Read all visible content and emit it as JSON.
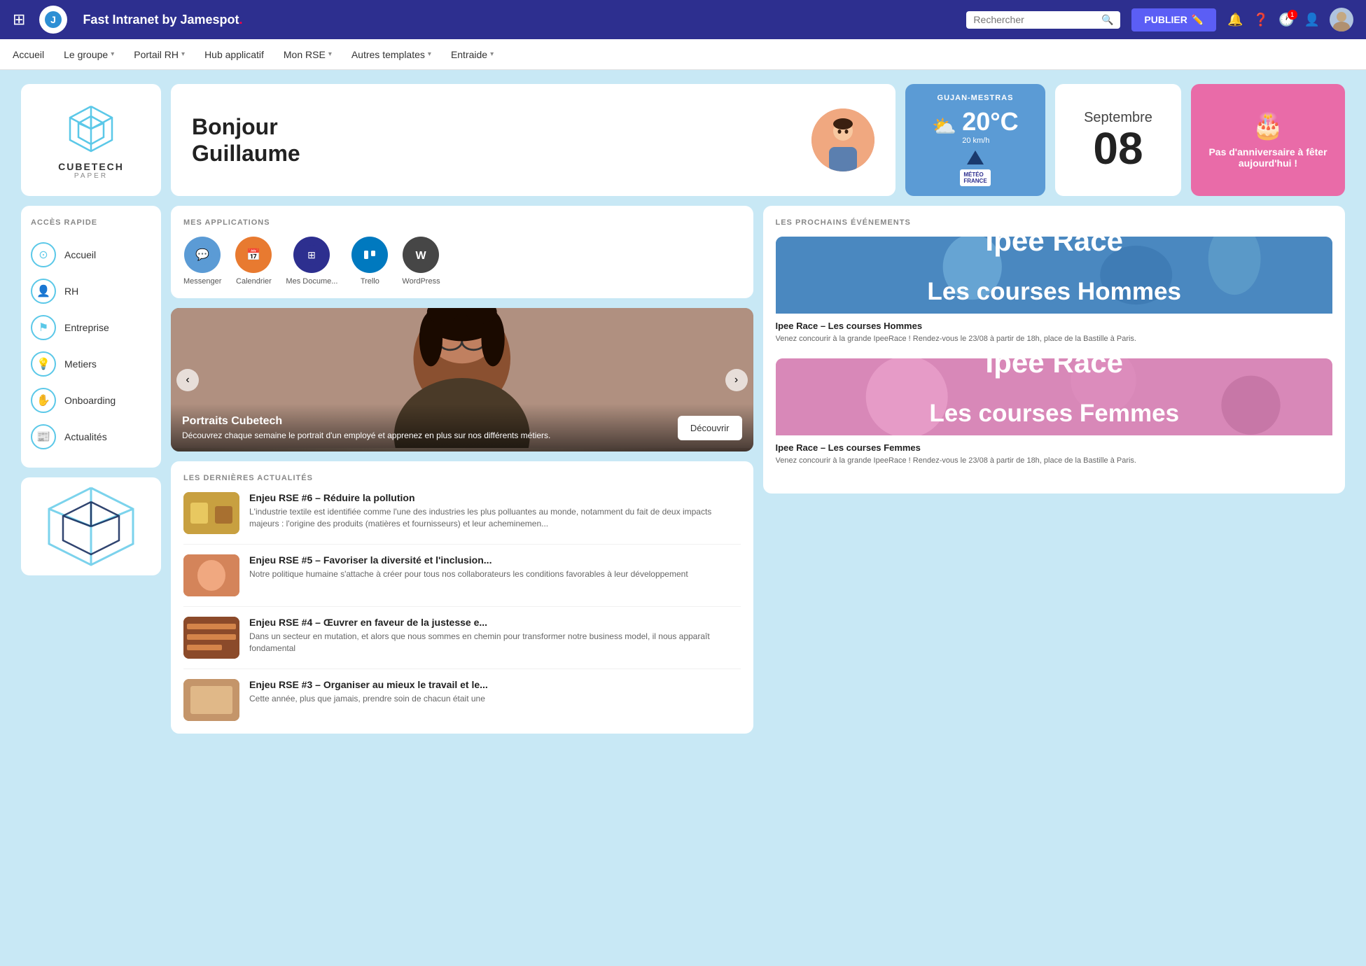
{
  "brand": {
    "title": "Fast Intranet by Jamespot",
    "title_part1": "Fast Intranet by Jamespot",
    "dot": "."
  },
  "topnav": {
    "search_placeholder": "Rechercher",
    "publish_label": "PUBLIER",
    "notification_count": "1"
  },
  "secnav": {
    "items": [
      {
        "label": "Accueil",
        "has_dropdown": false
      },
      {
        "label": "Le groupe",
        "has_dropdown": true
      },
      {
        "label": "Portail RH",
        "has_dropdown": true
      },
      {
        "label": "Hub applicatif",
        "has_dropdown": false
      },
      {
        "label": "Mon RSE",
        "has_dropdown": true
      },
      {
        "label": "Autres templates",
        "has_dropdown": true
      },
      {
        "label": "Entraide",
        "has_dropdown": true
      }
    ]
  },
  "greeting": {
    "line1": "Bonjour",
    "line2": "Guillaume"
  },
  "weather": {
    "city": "GUJAN-MESTRAS",
    "temp": "20°C",
    "wind": "20 km/h",
    "logo": "MÉTÉO FRANCE"
  },
  "date": {
    "month": "Septembre",
    "day": "08"
  },
  "birthday": {
    "message": "Pas d'anniversaire à fêter aujourd'hui !"
  },
  "quick_access": {
    "title": "ACCÈS RAPIDE",
    "items": [
      {
        "label": "Accueil",
        "icon": "⊙"
      },
      {
        "label": "RH",
        "icon": "👤"
      },
      {
        "label": "Entreprise",
        "icon": "⚑"
      },
      {
        "label": "Metiers",
        "icon": "💡"
      },
      {
        "label": "Onboarding",
        "icon": "✋"
      },
      {
        "label": "Actualités",
        "icon": "📰"
      }
    ]
  },
  "apps": {
    "title": "MES APPLICATIONS",
    "items": [
      {
        "label": "Messenger",
        "color": "#5b9bd5",
        "icon": "💬"
      },
      {
        "label": "Calendrier",
        "color": "#e87a30",
        "icon": "📅"
      },
      {
        "label": "Mes Docume...",
        "color": "#2d2f8f",
        "icon": "⊞"
      },
      {
        "label": "Trello",
        "color": "#0079bf",
        "icon": "▦"
      },
      {
        "label": "WordPress",
        "color": "#464646",
        "icon": "W"
      }
    ]
  },
  "carousel": {
    "title": "Portraits Cubetech",
    "description": "Découvrez chaque semaine le portrait d'un employé et apprenez en plus sur nos différents métiers.",
    "cta": "Découvrir"
  },
  "news": {
    "title": "LES DERNIÈRES ACTUALITÉS",
    "items": [
      {
        "title": "Enjeu RSE #6 – Réduire la pollution",
        "desc": "L'industrie textile est identifiée comme l'une des industries les plus polluantes au monde, notamment du fait de deux impacts majeurs : l'origine des produits (matières et fournisseurs) et leur acheminemen...",
        "thumb_color": "#c8a040"
      },
      {
        "title": "Enjeu RSE #5 – Favoriser la diversité et l'inclusion...",
        "desc": "Notre politique humaine s'attache à créer pour tous nos collaborateurs les conditions favorables à leur développement",
        "thumb_color": "#d4845a"
      },
      {
        "title": "Enjeu RSE #4 – Œuvrer en faveur de la justesse e...",
        "desc": "Dans un secteur en mutation, et alors que nous sommes en chemin pour transformer notre business model, il nous apparaît fondamental",
        "thumb_color": "#8b4a2a"
      },
      {
        "title": "Enjeu RSE #3 – Organiser au mieux le travail et le...",
        "desc": "Cette année, plus que jamais, prendre soin de chacun était une",
        "thumb_color": "#c4956a"
      }
    ]
  },
  "events": {
    "title": "LES PROCHAINS ÉVÉNEMENTS",
    "items": [
      {
        "banner_label1": "Ipee Race",
        "banner_label2": "Les courses Hommes",
        "title": "Ipee Race – Les courses Hommes",
        "desc": "Venez concourir à la grande IpeeRace ! Rendez-vous le 23/08 à partir de 18h, place de la Bastille à Paris.",
        "bg_color": "#4a8ab5"
      },
      {
        "banner_label1": "Ipee Race",
        "banner_label2": "Les courses Femmes",
        "title": "Ipee Race – Les courses Femmes",
        "desc": "Venez concourir à la grande IpeeRace ! Rendez-vous le 23/08 à partir de 18h, place de la Bastille à Paris.",
        "bg_color": "#e096b4"
      }
    ]
  }
}
